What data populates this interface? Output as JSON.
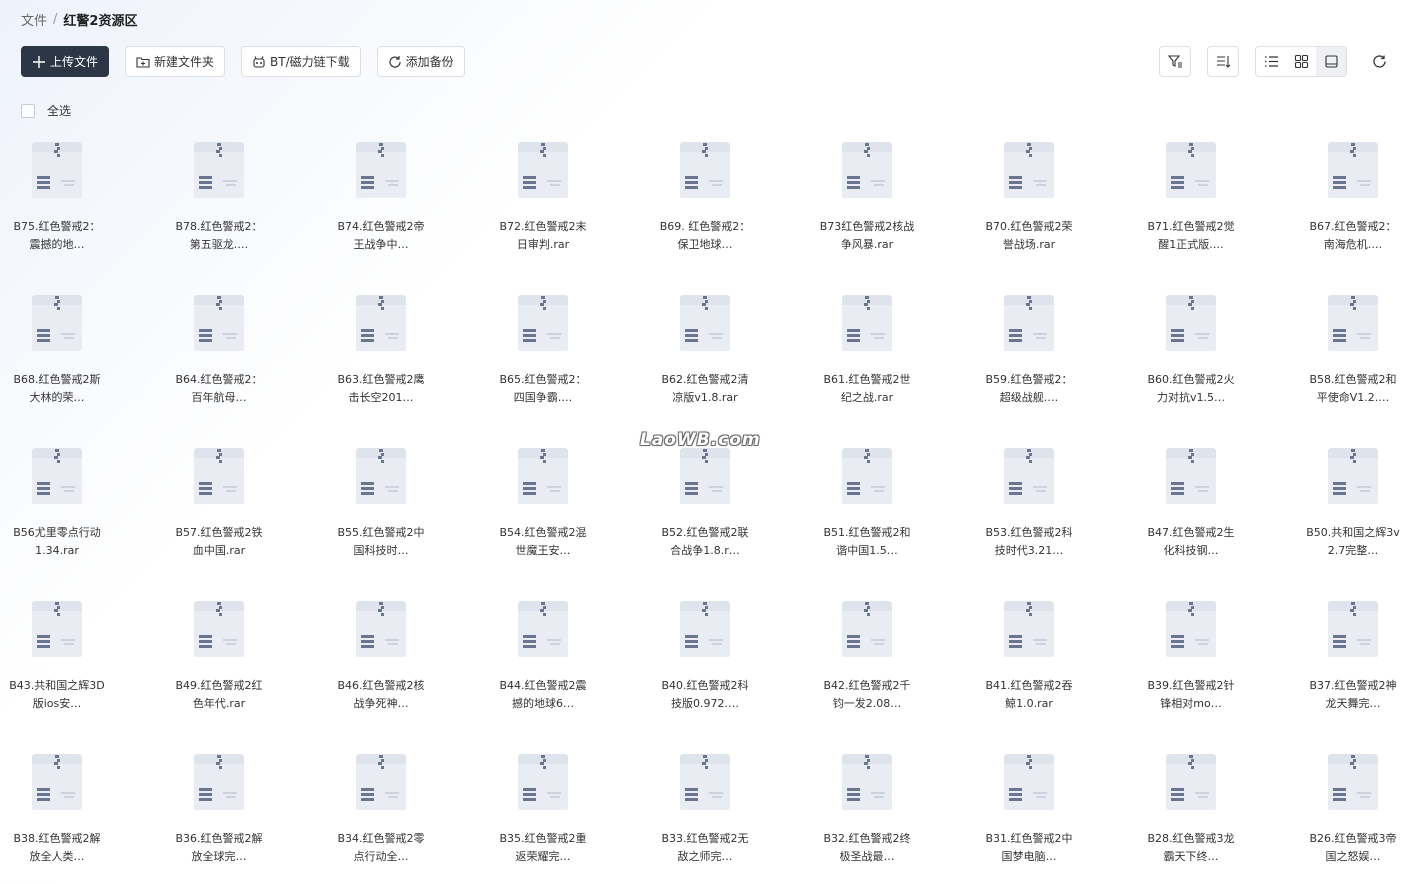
{
  "breadcrumb": {
    "root": "文件",
    "separator": "/",
    "current": "红警2资源区"
  },
  "toolbar": {
    "upload": "上传文件",
    "new_folder": "新建文件夹",
    "bt_download": "BT/磁力链下载",
    "add_backup": "添加备份"
  },
  "select_all": "全选",
  "watermark": "LaoWB.com",
  "files": [
    "B75.红色警戒2：震撼的地…",
    "B78.红色警戒2：第五驱龙.…",
    "B74.红色警戒2帝王战争中…",
    "B72.红色警戒2末日审判.rar",
    "B69. 红色警戒2：保卫地球…",
    "B73红色警戒2核战争风暴.rar",
    "B70.红色警戒2荣誉战场.rar",
    "B71.红色警戒2觉醒1正式版.…",
    "B67.红色警戒2：南海危机.…",
    "B68.红色警戒2斯大林的荣…",
    "B64.红色警戒2：百年航母…",
    "B63.红色警戒2鹰击长空201…",
    "B65.红色警戒2：四国争霸.…",
    "B62.红色警戒2清凉版v1.8.rar",
    "B61.红色警戒2世纪之战.rar",
    "B59.红色警戒2：超级战舰.…",
    "B60.红色警戒2火力对抗v1.5…",
    "B58.红色警戒2和平使命V1.2.…",
    "B56尤里零点行动1.34.rar",
    "B57.红色警戒2铁血中国.rar",
    "B55.红色警戒2中国科技时…",
    "B54.红色警戒2混世魔王安…",
    "B52.红色警戒2联合战争1.8.r…",
    "B51.红色警戒2和谐中国1.5…",
    "B53.红色警戒2科技时代3.21…",
    "B47.红色警戒2生化科技钢…",
    "B50.共和国之辉3v2.7完整…",
    "B43.共和国之辉3D版ios安…",
    "B49.红色警戒2红色年代.rar",
    "B46.红色警戒2核战争死神…",
    "B44.红色警戒2震撼的地球6…",
    "B40.红色警戒2科技版0.972.…",
    "B42.红色警戒2千钧一发2.08…",
    "B41.红色警戒2吞鲸1.0.rar",
    "B39.红色警戒2针锋相对mo…",
    "B37.红色警戒2神龙天舞完…",
    "B38.红色警戒2解放全人类…",
    "B36.红色警戒2解放全球完…",
    "B34.红色警戒2零点行动全…",
    "B35.红色警戒2重返荣耀完…",
    "B33.红色警戒2无敌之师完…",
    "B32.红色警戒2终极圣战最…",
    "B31.红色警戒2中国梦电脑…",
    "B28.红色警戒3龙霸天下终…",
    "B26.红色警戒3帝国之怒娱…"
  ]
}
